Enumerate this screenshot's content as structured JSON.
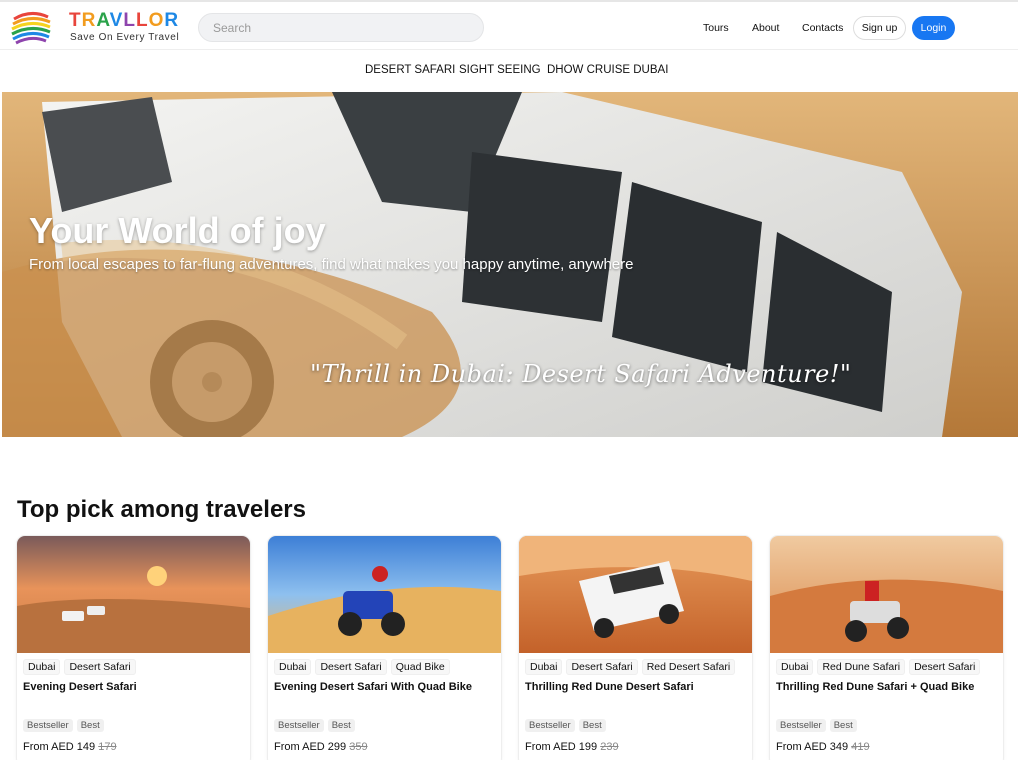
{
  "header": {
    "brand": "TRAVLLOR",
    "tagline": "Save On Every Travel",
    "search_placeholder": "Search",
    "nav": [
      "Tours",
      "About",
      "Contacts"
    ],
    "signup_label": "Sign up",
    "login_label": "Login"
  },
  "subnav": [
    "DESERT SAFARI",
    "SIGHT SEEING",
    "DHOW CRUISE DUBAI"
  ],
  "hero": {
    "title": "Your World of joy",
    "subtitle": "From local escapes to far-flung adventures, find what makes you happy anytime, anywhere",
    "quote": "\"Thrill in Dubai: Desert Safari Adventure!\""
  },
  "section_title": "Top pick among travelers",
  "cards": [
    {
      "tags": [
        "Dubai",
        "Desert Safari"
      ],
      "title": "Evening Desert Safari",
      "badges": [
        "Bestseller",
        "Best"
      ],
      "price_prefix": "From AED 149",
      "old_price": "179"
    },
    {
      "tags": [
        "Dubai",
        "Desert Safari",
        "Quad Bike"
      ],
      "title": "Evening Desert Safari With Quad Bike",
      "badges": [
        "Bestseller",
        "Best"
      ],
      "price_prefix": "From AED 299",
      "old_price": "359"
    },
    {
      "tags": [
        "Dubai",
        "Desert Safari",
        "Red Desert Safari"
      ],
      "title": "Thrilling Red Dune Desert Safari",
      "badges": [
        "Bestseller",
        "Best"
      ],
      "price_prefix": "From AED 199",
      "old_price": "239"
    },
    {
      "tags": [
        "Dubai",
        "Red Dune Safari",
        "Desert Safari"
      ],
      "title": "Thrilling Red Dune Safari + Quad Bike",
      "badges": [
        "Bestseller",
        "Best"
      ],
      "price_prefix": "From AED 349",
      "old_price": "419"
    }
  ],
  "colors": {
    "accent": "#1877f2",
    "brand_letters": [
      "#e8453c",
      "#f29c1f",
      "#2aa24a",
      "#1e88e5",
      "#8e44ad",
      "#e8453c",
      "#f29c1f",
      "#1e88e5"
    ]
  }
}
